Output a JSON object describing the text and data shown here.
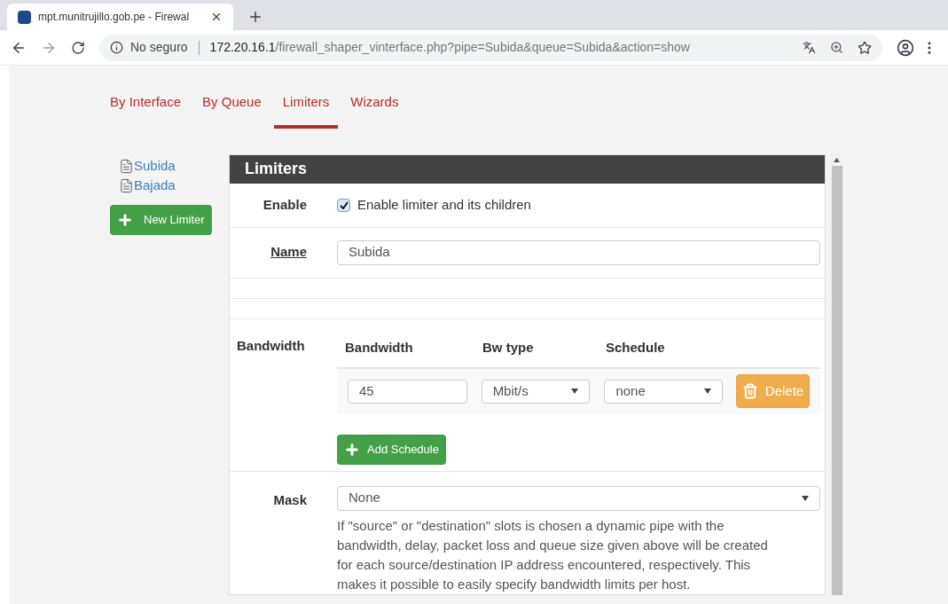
{
  "browser": {
    "tab_title": "mpt.munitrujillo.gob.pe - Firewal",
    "security": "No seguro",
    "url_host": "172.20.16.1",
    "url_path": "/firewall_shaper_vinterface.php?pipe=Subida&queue=Subida&action=show"
  },
  "nav_tabs": [
    {
      "label": "By Interface",
      "selected": false
    },
    {
      "label": "By Queue",
      "selected": false
    },
    {
      "label": "Limiters",
      "selected": true
    },
    {
      "label": "Wizards",
      "selected": false
    }
  ],
  "tree": [
    {
      "label": "Subida"
    },
    {
      "label": "Bajada"
    }
  ],
  "new_limiter_button": "New Limiter",
  "panel": {
    "title": "Limiters",
    "enable": {
      "label": "Enable",
      "checked": true,
      "text": "Enable limiter and its children"
    },
    "name": {
      "label": "Name",
      "value": "Subida"
    },
    "bandwidth": {
      "label": "Bandwidth",
      "columns": [
        "Bandwidth",
        "Bw type",
        "Schedule"
      ],
      "rows": [
        {
          "bandwidth": "45",
          "bw_type": "Mbit/s",
          "schedule": "none",
          "delete": "Delete"
        }
      ],
      "add_button": "Add Schedule"
    },
    "mask": {
      "label": "Mask",
      "value": "None",
      "help": "If \"source\" or \"destination\" slots is chosen a dynamic pipe with the bandwidth, delay, packet loss and queue size given above will be created for each source/destination IP address encountered, respectively. This makes it possible to easily specify bandwidth limits per host."
    }
  }
}
